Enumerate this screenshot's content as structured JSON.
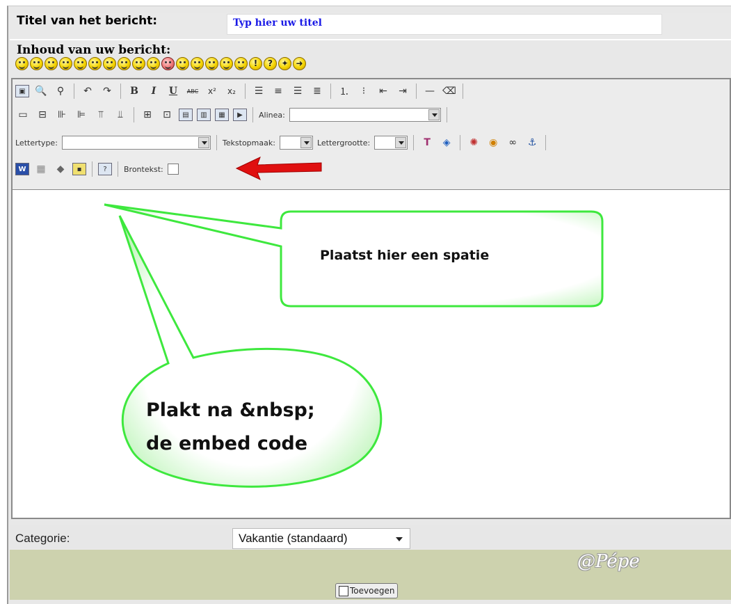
{
  "form": {
    "title_label": "Titel van het bericht:",
    "title_placeholder": "Typ hier uw titel",
    "content_label": "Inhoud van uw bericht:"
  },
  "smileys": [
    "smile",
    "grin",
    "sad",
    "worried",
    "dizzy",
    "laugh",
    "cool",
    "happy",
    "tongue",
    "big-grin",
    "red-angry",
    "frown",
    "devil",
    "evil",
    "neutral",
    "wink",
    "exclamation",
    "question",
    "idea",
    "arrow"
  ],
  "toolbar": {
    "alinea_label": "Alinea:",
    "lettertype_label": "Lettertype:",
    "tekstopmaak_label": "Tekstopmaak:",
    "lettergrootte_label": "Lettergrootte:",
    "brontekst_label": "Brontekst:",
    "bold": "B",
    "italic": "I",
    "underline": "U",
    "strike": "ABC",
    "help": "?"
  },
  "annotations": {
    "callout_top": "Plaatst hier een spatie",
    "callout_bottom_line1": "Plakt na &nbsp;",
    "callout_bottom_line2": "de embed code"
  },
  "category": {
    "label": "Categorie:",
    "value": "Vakantie (standaard)"
  },
  "footer": {
    "signature": "@Pépe",
    "submit_label": "Toevoegen"
  },
  "colors": {
    "callout_border": "#3ee83e",
    "arrow": "#e01010",
    "title_text": "#1a1ae6",
    "footer_bg": "#cdd2ae"
  }
}
